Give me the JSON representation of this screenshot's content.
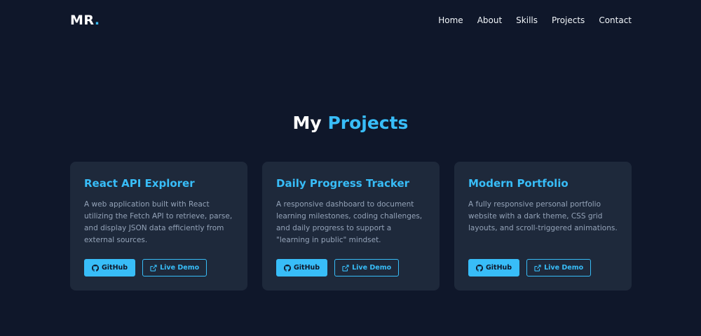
{
  "nav": {
    "logo_text": "MR",
    "logo_dot": ".",
    "links": [
      "Home",
      "About",
      "Skills",
      "Projects",
      "Contact"
    ]
  },
  "section": {
    "heading_main": "My",
    "heading_accent": "Projects"
  },
  "projects": [
    {
      "title": "React API Explorer",
      "description": "A web application built with React utilizing the Fetch API to retrieve, parse, and display JSON data efficiently from external sources.",
      "github_label": "GitHub",
      "demo_label": "Live Demo"
    },
    {
      "title": "Daily Progress Tracker",
      "description": "A responsive dashboard to document learning milestones, coding challenges, and daily progress to support a \"learning in public\" mindset.",
      "github_label": "GitHub",
      "demo_label": "Live Demo"
    },
    {
      "title": "Modern Portfolio",
      "description": "A fully responsive personal portfolio website with a dark theme, CSS grid layouts, and scroll-triggered animations.",
      "github_label": "GitHub",
      "demo_label": "Live Demo"
    }
  ],
  "colors": {
    "background": "#0f172a",
    "card": "#1e293b",
    "accent": "#38bdf8",
    "text_muted": "#94a3b8"
  },
  "icons": {
    "github": "github-icon",
    "external": "external-link-icon"
  }
}
